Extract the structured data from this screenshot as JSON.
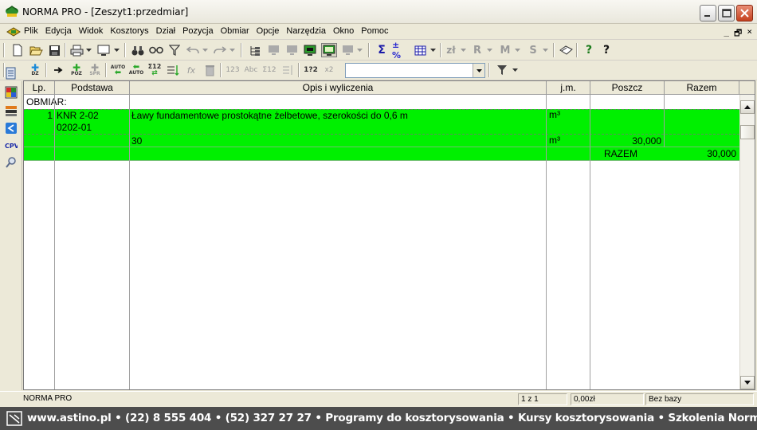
{
  "window": {
    "title": "NORMA PRO - [Zeszyt1:przedmiar]"
  },
  "menu": {
    "items": [
      "Plik",
      "Edycja",
      "Widok",
      "Kosztorys",
      "Dział",
      "Pozycja",
      "Obmiar",
      "Opcje",
      "Narzędzia",
      "Okno",
      "Pomoc"
    ],
    "mdi_buttons": [
      "_",
      "🗗",
      "×"
    ]
  },
  "toolbar1": {
    "labels": [
      "Σ",
      "±%",
      "zł",
      "R",
      "M",
      "S",
      "?",
      "?"
    ]
  },
  "toolbar2": {
    "labels": [
      "DZ",
      "POZ",
      "SPR",
      "AUTO",
      "AUTO",
      "Σ12",
      "fx",
      "123",
      "Abc",
      "Σ12",
      "1?2",
      "x2"
    ],
    "filter_combo_value": ""
  },
  "grid": {
    "columns": [
      "Lp.",
      "Podstawa",
      "Opis i wyliczenia",
      "j.m.",
      "Poszcz",
      "Razem"
    ],
    "section_label": "OBMIAR:",
    "row": {
      "lp": "1",
      "podstawa_line1": "KNR 2-02",
      "podstawa_line2": "0202-01",
      "opis": "Ławy fundamentowe prostokątne żelbetowe, szerokości do 0,6 m",
      "jm": "m³"
    },
    "calc_row": {
      "opis": "30",
      "jm": "m³",
      "poszcz": "30,000"
    },
    "sum_row": {
      "label": "RAZEM",
      "razem": "30,000"
    }
  },
  "status": {
    "app": "NORMA PRO",
    "page": "1 z 1",
    "amount": "0,00zł",
    "base": "Bez bazy"
  },
  "footer": {
    "text": "www.astino.pl • (22) 8 555 404 • (52) 327 27 27 • Programy do kosztorysowania • Kursy kosztorysowania • Szkolenia Norma PRO"
  },
  "colors": {
    "highlight_row": "#00f000",
    "footer_bg": "#4d4d4d",
    "chrome": "#ece9d8"
  }
}
